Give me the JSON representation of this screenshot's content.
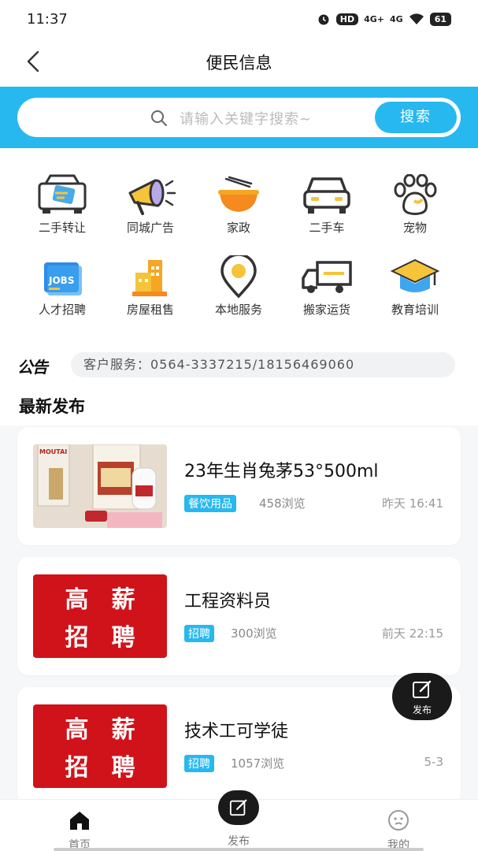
{
  "status": {
    "time": "11:37",
    "hd": "HD",
    "net1": "4G+",
    "net2": "4G",
    "battery": "61"
  },
  "nav": {
    "title": "便民信息",
    "back_icon": "chevron-left-icon"
  },
  "search": {
    "placeholder": "请输入关键字搜索~",
    "button_label": "搜索",
    "accent": "#27b8f0"
  },
  "categories": [
    {
      "label": "二手转让",
      "icon": "transfer-icon"
    },
    {
      "label": "同城广告",
      "icon": "megaphone-icon"
    },
    {
      "label": "家政",
      "icon": "bowl-icon"
    },
    {
      "label": "二手车",
      "icon": "car-icon"
    },
    {
      "label": "宠物",
      "icon": "paw-icon"
    },
    {
      "label": "人才招聘",
      "icon": "jobs-icon"
    },
    {
      "label": "房屋租售",
      "icon": "house-icon"
    },
    {
      "label": "本地服务",
      "icon": "location-icon"
    },
    {
      "label": "搬家运货",
      "icon": "truck-icon"
    },
    {
      "label": "教育培训",
      "icon": "graduation-cap-icon"
    }
  ],
  "notice": {
    "tag": "公告",
    "text": "客户服务：0564-3337215/18156469060"
  },
  "section_title": "最新发布",
  "posts": [
    {
      "title": "23年生肖兔茅53°500ml",
      "category": "餐饮用品",
      "views": "458浏览",
      "date": "昨天 16:41",
      "thumb_text": "MOUTAI"
    },
    {
      "title": "工程资料员",
      "category": "招聘",
      "views": "300浏览",
      "date": "前天 22:15",
      "thumb_text": [
        "高",
        "薪",
        "招",
        "聘"
      ]
    },
    {
      "title": "技术工可学徒",
      "category": "招聘",
      "views": "1057浏览",
      "date": "5-3",
      "thumb_text": [
        "高",
        "薪",
        "招",
        "聘"
      ]
    }
  ],
  "fab": {
    "label": "发布"
  },
  "tabs": [
    {
      "label": "首页",
      "icon": "home-icon"
    },
    {
      "label": "发布",
      "icon": "edit-icon"
    },
    {
      "label": "我的",
      "icon": "smiley-icon"
    }
  ]
}
